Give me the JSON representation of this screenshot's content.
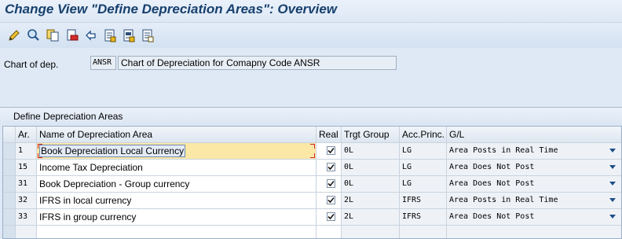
{
  "window": {
    "title": "Change View \"Define Depreciation Areas\": Overview"
  },
  "toolbar": {
    "buttons": [
      {
        "name": "edit-icon"
      },
      {
        "name": "display-change-icon"
      },
      {
        "name": "copy-icon"
      },
      {
        "name": "delete-icon"
      },
      {
        "name": "undo-icon"
      },
      {
        "name": "select-all-icon"
      },
      {
        "name": "select-block-icon"
      },
      {
        "name": "deselect-all-icon"
      }
    ]
  },
  "header": {
    "chart_label": "Chart of dep.",
    "chart_code": "ANSR",
    "chart_desc": "Chart of Depreciation for Comapny Code ANSR"
  },
  "table": {
    "title": "Define Depreciation Areas",
    "columns": [
      "Ar.",
      "Name of Depreciation Area",
      "Real",
      "Trgt Group",
      "Acc.Princ.",
      "G/L"
    ],
    "rows": [
      {
        "ar": "1",
        "name": "Book Depreciation Local Currency",
        "real": true,
        "group": "0L",
        "acc": "LG",
        "gl": "Area Posts in Real Time"
      },
      {
        "ar": "15",
        "name": "Income Tax Depreciation",
        "real": true,
        "group": "0L",
        "acc": "LG",
        "gl": "Area Does Not Post"
      },
      {
        "ar": "31",
        "name": "Book Depreciation - Group currency",
        "real": true,
        "group": "0L",
        "acc": "LG",
        "gl": "Area Does Not Post"
      },
      {
        "ar": "32",
        "name": "IFRS in local currency",
        "real": true,
        "group": "2L",
        "acc": "IFRS",
        "gl": "Area Posts in Real Time"
      },
      {
        "ar": "33",
        "name": "IFRS in group currency",
        "real": true,
        "group": "2L",
        "acc": "IFRS",
        "gl": "Area Does Not Post"
      }
    ]
  },
  "colors": {
    "title": "#17406d",
    "edit_cell": "#fbe8a6",
    "dropdown_arrow": "#1d4e86"
  }
}
